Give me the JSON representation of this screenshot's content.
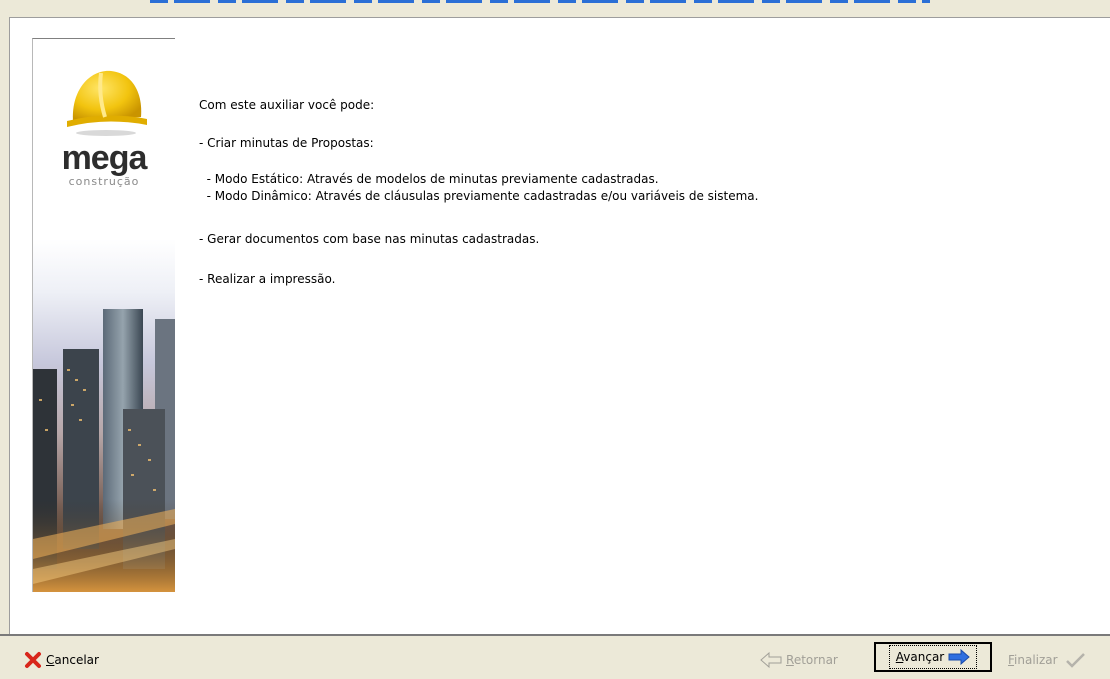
{
  "wizard": {
    "intro": "Com este auxiliar você pode:",
    "lines": [
      "- Criar minutas de Propostas:",
      "  - Modo Estático: Através de modelos de minutas previamente cadastradas.",
      "  - Modo Dinâmico: Através de cláusulas previamente cadastradas e/ou variáveis de sistema.",
      "- Gerar documentos com base nas minutas cadastradas.",
      "- Realizar a impressão."
    ]
  },
  "branding": {
    "logo_main": "mega",
    "logo_sub": "construção"
  },
  "footer": {
    "cancel_label": "Cancelar",
    "back_label": "Retornar",
    "next_label": "Avançar",
    "finish_label": "Finalizar"
  },
  "colors": {
    "accent_blue": "#2b6fd6",
    "hat_yellow": "#f2c40f",
    "cancel_red": "#d8261b",
    "dialog_bg": "#ece9d8"
  },
  "icons": {
    "cancel": "x-icon",
    "back": "arrow-left-icon",
    "next": "arrow-right-icon",
    "finish": "checkmark-icon"
  }
}
